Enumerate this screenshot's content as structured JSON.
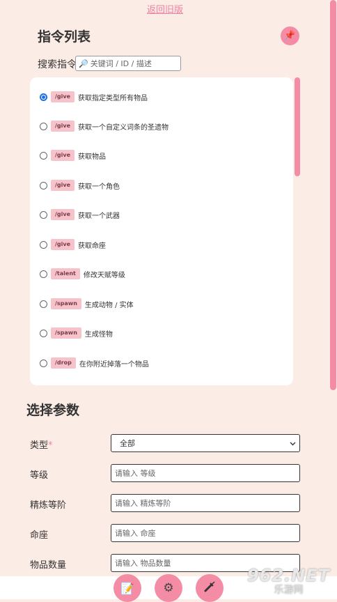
{
  "back_link": "返回旧版",
  "command_list": {
    "title": "指令列表",
    "pin_icon": "pushpin-icon",
    "search_label": "搜索指令",
    "search_placeholder": "关键词 / ID / 描述",
    "selected_index": 0,
    "items": [
      {
        "cmd": "/give",
        "desc": "获取指定类型所有物品"
      },
      {
        "cmd": "/give",
        "desc": "获取一个自定义词条的圣遗物"
      },
      {
        "cmd": "/give",
        "desc": "获取物品"
      },
      {
        "cmd": "/give",
        "desc": "获取一个角色"
      },
      {
        "cmd": "/give",
        "desc": "获取一个武器"
      },
      {
        "cmd": "/give",
        "desc": "获取命座"
      },
      {
        "cmd": "/talent",
        "desc": "修改天赋等级"
      },
      {
        "cmd": "/spawn",
        "desc": "生成动物 / 实体"
      },
      {
        "cmd": "/spawn",
        "desc": "生成怪物"
      },
      {
        "cmd": "/drop",
        "desc": "在你附近掉落一个物品"
      }
    ]
  },
  "params": {
    "title": "选择参数",
    "fields": [
      {
        "label": "类型",
        "required": "*",
        "value": "全部"
      },
      {
        "label": "等级",
        "placeholder": "请输入 等级"
      },
      {
        "label": "精炼等阶",
        "placeholder": "请输入 精炼等阶"
      },
      {
        "label": "命座",
        "placeholder": "请输入 命座"
      },
      {
        "label": "物品数量",
        "placeholder": "请输入 物品数量"
      }
    ]
  },
  "bottom_buttons": [
    "memo-icon",
    "gear-icon",
    "syringe-icon"
  ],
  "watermark": {
    "top": "962.NET",
    "bottom": "乐游网"
  }
}
